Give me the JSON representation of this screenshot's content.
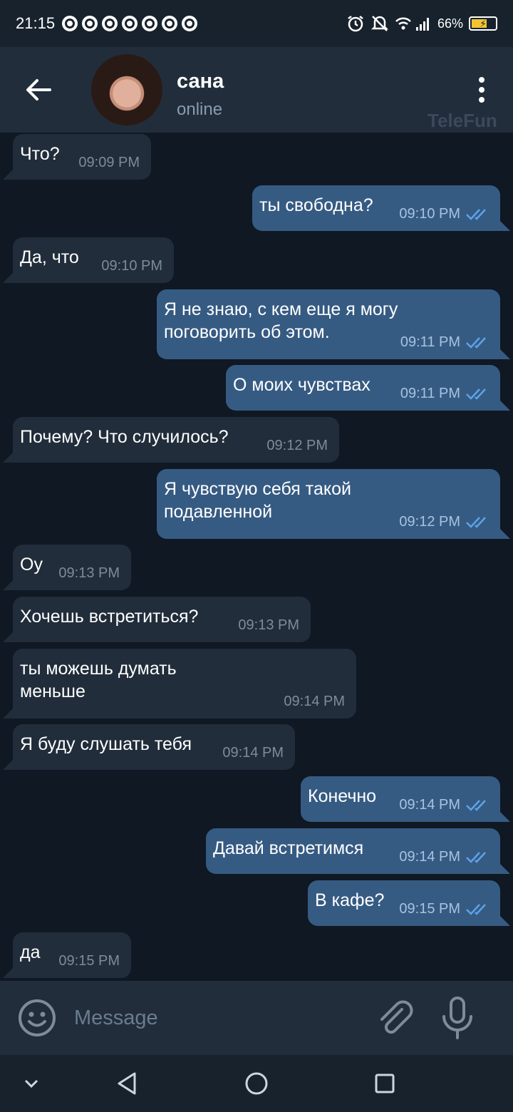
{
  "status_bar": {
    "time": "21:15",
    "battery": "66%",
    "battery_level": 0.66
  },
  "header": {
    "contact_name": "сана",
    "contact_status": "online",
    "watermark": "TeleFun"
  },
  "messages": [
    {
      "direction": "in",
      "text": "Что?",
      "time": "09:09 PM"
    },
    {
      "direction": "out",
      "text": "ты свободна?",
      "time": "09:10 PM",
      "read": true
    },
    {
      "direction": "in",
      "text": "Да, что",
      "time": "09:10 PM"
    },
    {
      "direction": "out",
      "text": "Я не знаю, с кем еще я могу\nпоговорить об этом.",
      "time": "09:11 PM",
      "read": true
    },
    {
      "direction": "out",
      "text": "О моих чувствах",
      "time": "09:11 PM",
      "read": true
    },
    {
      "direction": "in",
      "text": "Почему? Что случилось?",
      "time": "09:12 PM"
    },
    {
      "direction": "out",
      "text": "Я чувствую себя такой\nподавленной",
      "time": "09:12 PM",
      "read": true
    },
    {
      "direction": "in",
      "text": "Оу",
      "time": "09:13 PM"
    },
    {
      "direction": "in",
      "text": "Хочешь встретиться?",
      "time": "09:13 PM"
    },
    {
      "direction": "in",
      "text": "ты можешь думать\nменьше",
      "time": "09:14 PM"
    },
    {
      "direction": "in",
      "text": "Я буду слушать тебя",
      "time": "09:14 PM"
    },
    {
      "direction": "out",
      "text": "Конечно",
      "time": "09:14 PM",
      "read": true
    },
    {
      "direction": "out",
      "text": "Давай встретимся",
      "time": "09:14 PM",
      "read": true
    },
    {
      "direction": "out",
      "text": "В кафе?",
      "time": "09:15 PM",
      "read": true
    },
    {
      "direction": "in",
      "text": "да",
      "time": "09:15 PM"
    }
  ],
  "input": {
    "placeholder": "Message"
  },
  "icons": {
    "back": "arrow-left-icon",
    "menu": "more-vertical-icon",
    "emoji": "emoji-icon",
    "attach": "paperclip-icon",
    "mic": "microphone-icon",
    "read_ticks": "double-check-icon"
  },
  "colors": {
    "background": "#0f1823",
    "incoming_bubble": "#212d3b",
    "outgoing_bubble": "#365b83",
    "read_ticks": "#5ea3e8"
  }
}
